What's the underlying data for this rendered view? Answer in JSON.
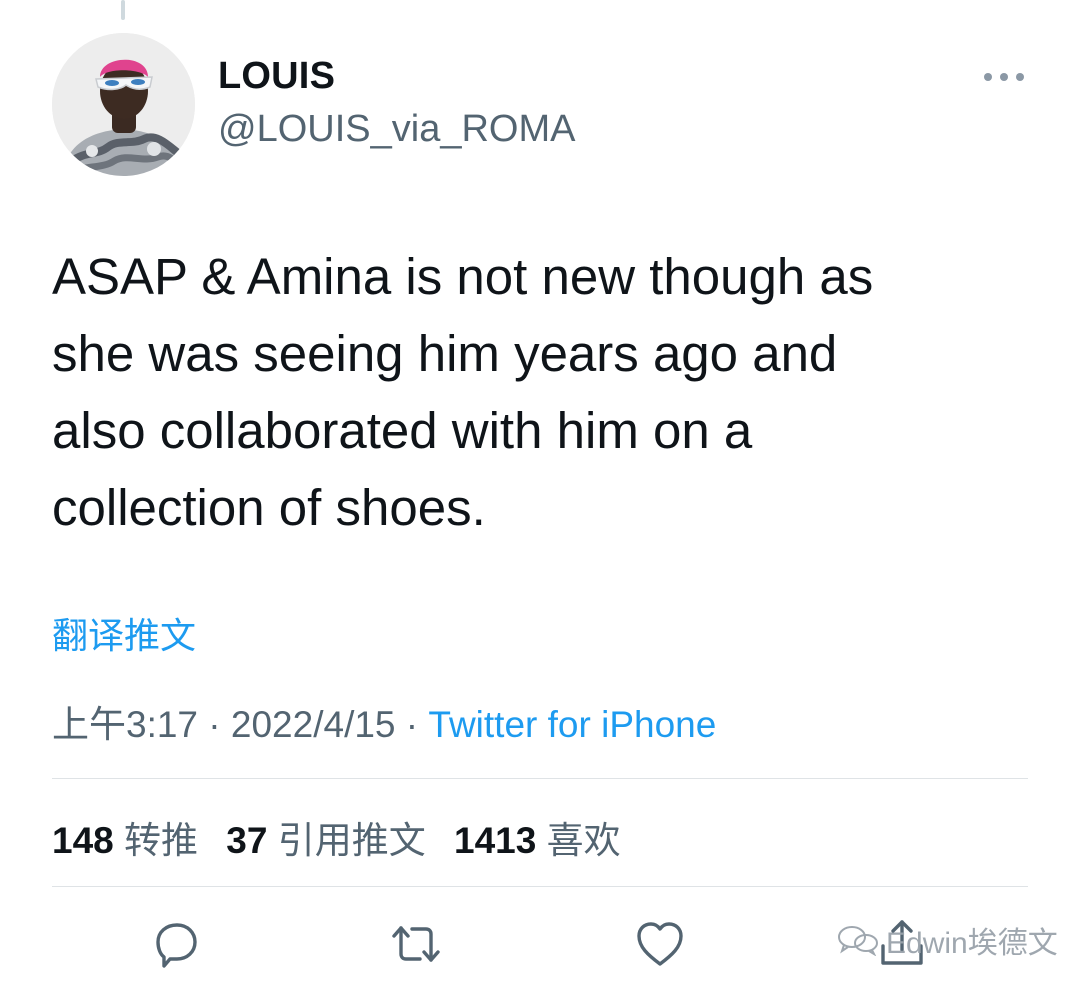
{
  "author": {
    "display_name": "LOUIS",
    "handle": "@LOUIS_via_ROMA"
  },
  "tweet": {
    "text": "ASAP & Amina is not new though as\nshe was seeing him years ago and\nalso collaborated with him on a\ncollection of shoes.",
    "translate_label": "翻译推文",
    "time": "上午3:17",
    "separator": "·",
    "date": "2022/4/15",
    "source": "Twitter for iPhone"
  },
  "stats": {
    "retweets_count": "148",
    "retweets_label": "转推",
    "quotes_count": "37",
    "quotes_label": "引用推文",
    "likes_count": "1413",
    "likes_label": "喜欢"
  },
  "actions": {
    "icons": [
      "reply-icon",
      "retweet-icon",
      "like-icon",
      "share-icon"
    ]
  },
  "watermark": {
    "text": "Edwin埃德文"
  },
  "colors": {
    "link_blue": "#1d9bf0",
    "secondary_gray": "#536471",
    "primary_text": "#0f1419",
    "divider": "#dfe3e6"
  }
}
